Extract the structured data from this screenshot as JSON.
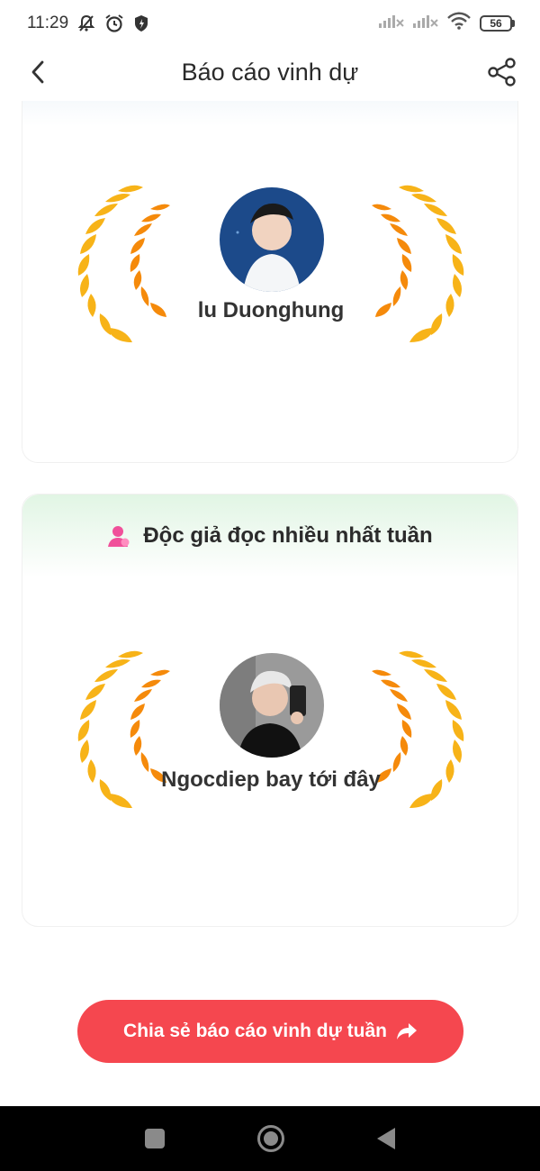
{
  "status_bar": {
    "time": "11:29",
    "battery": "56",
    "icons": [
      "mute-bell-icon",
      "alarm-icon",
      "shield-icon",
      "signal-icon",
      "signal-icon",
      "wifi-icon",
      "battery-icon"
    ]
  },
  "header": {
    "title": "Báo cáo vinh dự",
    "back_icon": "chevron-left-icon",
    "share_icon": "share-icon"
  },
  "cards": [
    {
      "winner_name": "lu Duonghung"
    },
    {
      "title": "Độc giả đọc nhiều nhất tuần",
      "title_icon": "person-icon",
      "winner_name": "Ngocdiep bay tới đây"
    }
  ],
  "share_button": {
    "label": "Chia sẻ báo cáo vinh dự tuần",
    "icon": "forward-arrow-icon",
    "color": "#f5474f"
  },
  "colors": {
    "laurel_gold": "#f7b318",
    "laurel_orange": "#f58a0b",
    "header_green": "#e1f5e4"
  }
}
